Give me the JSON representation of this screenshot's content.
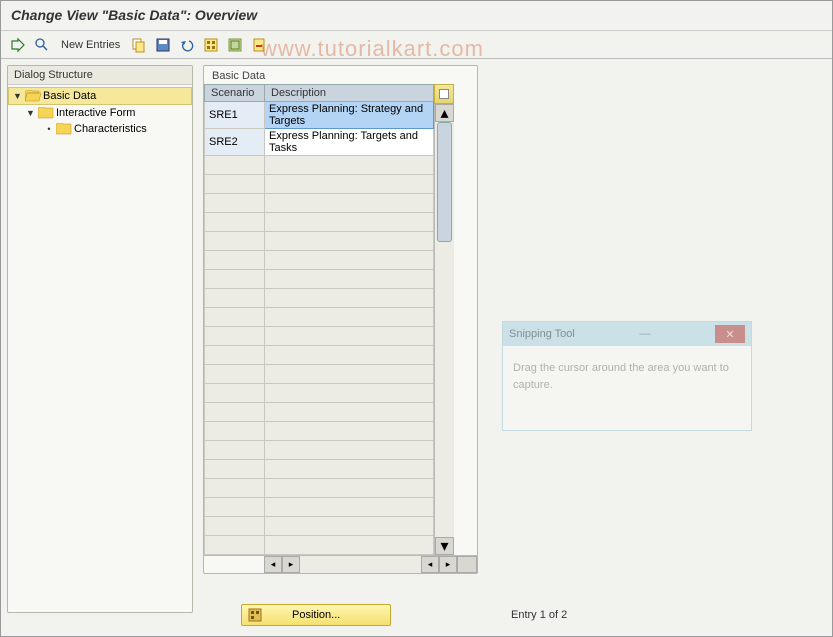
{
  "title": "Change View \"Basic Data\": Overview",
  "watermark": "www.tutorialkart.com",
  "toolbar": {
    "new_entries": "New Entries"
  },
  "dialog_structure": {
    "header": "Dialog Structure",
    "nodes": [
      {
        "label": "Basic Data",
        "selected": true
      },
      {
        "label": "Interactive Form"
      },
      {
        "label": "Characteristics"
      }
    ]
  },
  "table": {
    "title": "Basic Data",
    "columns": {
      "scenario": "Scenario",
      "description": "Description"
    },
    "rows": [
      {
        "scenario": "SRE1",
        "description": "Express Planning: Strategy and Targets",
        "selected": true
      },
      {
        "scenario": "SRE2",
        "description": "Express Planning: Targets and Tasks"
      }
    ]
  },
  "footer": {
    "position": "Position...",
    "entry": "Entry 1 of 2"
  },
  "snip": {
    "title": "Snipping Tool",
    "body": "Drag the cursor around the area you want to capture."
  }
}
